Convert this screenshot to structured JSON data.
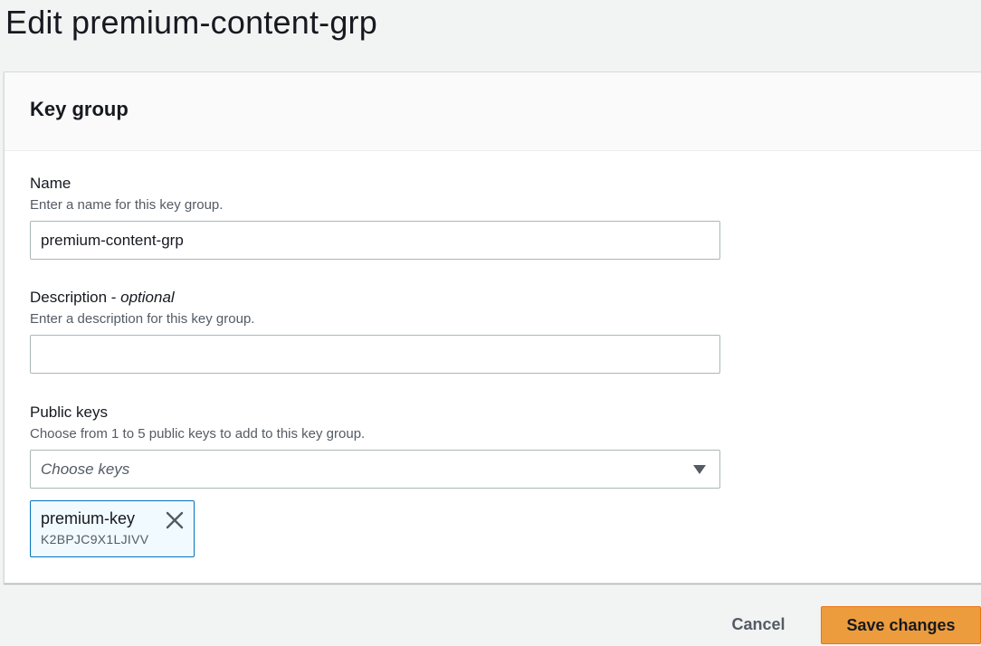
{
  "page": {
    "title": "Edit premium-content-grp"
  },
  "panel": {
    "title": "Key group"
  },
  "fields": {
    "name": {
      "label": "Name",
      "description": "Enter a name for this key group.",
      "value": "premium-content-grp"
    },
    "description": {
      "label": "Description - ",
      "optional": "optional",
      "description": "Enter a description for this key group.",
      "value": ""
    },
    "public_keys": {
      "label": "Public keys",
      "description": "Choose from 1 to 5 public keys to add to this key group.",
      "placeholder": "Choose keys",
      "selected": [
        {
          "label": "premium-key",
          "id": "K2BPJC9X1LJIVV"
        }
      ]
    }
  },
  "footer": {
    "cancel_label": "Cancel",
    "save_label": "Save changes"
  },
  "colors": {
    "accent": "#ec9c3d",
    "token_border": "#0073bb",
    "token_bg": "#f1faff"
  },
  "icons": {
    "dropdown": "caret-down-icon",
    "remove": "close-icon"
  }
}
